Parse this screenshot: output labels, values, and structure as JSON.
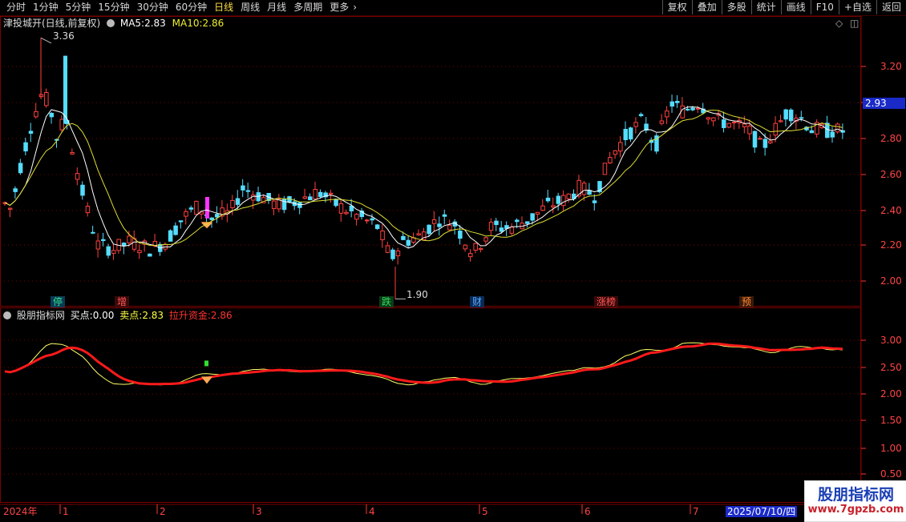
{
  "toolbar": {
    "periods": [
      "分时",
      "1分钟",
      "5分钟",
      "15分钟",
      "30分钟",
      "60分钟",
      "日线",
      "周线",
      "月线",
      "多周期",
      "更多"
    ],
    "active_period": "日线",
    "more_arrow": "›",
    "right_buttons": [
      "复权",
      "叠加",
      "多股",
      "统计",
      "画线",
      "F10",
      "+自选",
      "返回"
    ]
  },
  "main_legend": {
    "title": "津投城开(日线,前复权)",
    "ma5_label": "MA5:",
    "ma5_value": "2.83",
    "ma10_label": "MA10:",
    "ma10_value": "2.86"
  },
  "main_axis": {
    "ticks": [
      "3.20",
      "3.00",
      "2.80",
      "2.60",
      "2.40",
      "2.20",
      "2.00"
    ],
    "current_price": "2.93"
  },
  "annotations": {
    "high": "3.36",
    "low": "1.90"
  },
  "event_tags": [
    {
      "text": "停",
      "color": "#33dd88"
    },
    {
      "text": "增",
      "color": "#ff5555"
    },
    {
      "text": "跌",
      "color": "#33dd55"
    },
    {
      "text": "财",
      "color": "#55aaff"
    },
    {
      "text": "涨榜",
      "color": "#ff5555"
    },
    {
      "text": "预",
      "color": "#ff8833"
    }
  ],
  "sub_legend": {
    "title": "股朋指标网",
    "buy_label": "买点:",
    "buy_value": "0.00",
    "sell_label": "卖点:",
    "sell_value": "2.83",
    "fund_label": "拉升资金:",
    "fund_value": "2.86"
  },
  "sub_axis": {
    "ticks": [
      "3.00",
      "2.50",
      "2.00",
      "1.50",
      "1.00",
      "0.50"
    ]
  },
  "time_axis": {
    "labels": [
      "2024年",
      "1",
      "2",
      "3",
      "4",
      "5",
      "6",
      "7"
    ],
    "cursor_date": "2025/07/10/四"
  },
  "colors": {
    "up": "#ff4040",
    "down": "#55ddff",
    "ma5": "#ffffff",
    "ma10": "#dddd33",
    "fund": "#ff1a1a",
    "sell": "#ffff66",
    "grid": "#7a0000",
    "signal": "#ff33ff"
  },
  "watermark": {
    "title": "股朋指标网",
    "url": "www.7gpzb.com"
  }
}
